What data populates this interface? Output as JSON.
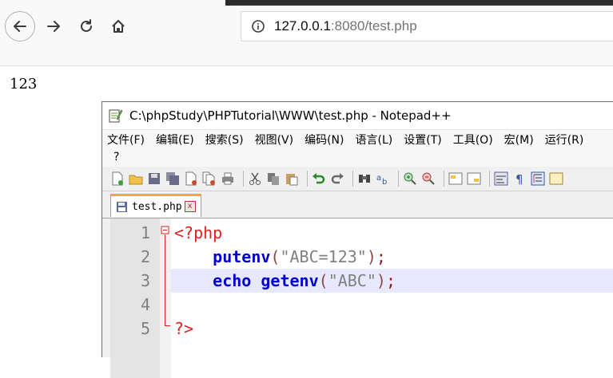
{
  "browser": {
    "url_host": "127.0.0.1",
    "url_rest": ":8080/test.php",
    "icons": [
      "back-arrow-icon",
      "forward-arrow-icon",
      "reload-icon",
      "home-icon",
      "info-icon"
    ]
  },
  "page": {
    "output_text": "123"
  },
  "notepad": {
    "title": "C:\\phpStudy\\PHPTutorial\\WWW\\test.php - Notepad++",
    "menu": [
      "文件(F)",
      "编辑(E)",
      "搜索(S)",
      "视图(V)",
      "编码(N)",
      "语言(L)",
      "设置(T)",
      "工具(O)",
      "宏(M)",
      "运行(R)"
    ],
    "menu_extra": "?",
    "tab": {
      "label": "test.php",
      "close": "x"
    },
    "lines": [
      {
        "num": "1",
        "parts": [
          {
            "cls": "php-tag",
            "text": "<?php"
          }
        ]
      },
      {
        "num": "2",
        "parts": [
          {
            "cls": "",
            "text": "    "
          },
          {
            "cls": "kw",
            "text": "putenv"
          },
          {
            "cls": "paren",
            "text": "("
          },
          {
            "cls": "str",
            "text": "\"ABC=123\""
          },
          {
            "cls": "paren",
            "text": ")"
          },
          {
            "cls": "semi",
            "text": ";"
          }
        ]
      },
      {
        "num": "3",
        "parts": [
          {
            "cls": "",
            "text": "    "
          },
          {
            "cls": "kw",
            "text": "echo"
          },
          {
            "cls": "",
            "text": " "
          },
          {
            "cls": "kw",
            "text": "getenv"
          },
          {
            "cls": "paren",
            "text": "("
          },
          {
            "cls": "str",
            "text": "\"ABC\""
          },
          {
            "cls": "paren",
            "text": ")"
          },
          {
            "cls": "semi",
            "text": ";"
          }
        ]
      },
      {
        "num": "4",
        "parts": []
      },
      {
        "num": "5",
        "parts": [
          {
            "cls": "php-tag",
            "text": "?>"
          }
        ]
      }
    ],
    "highlighted_line": 3
  }
}
